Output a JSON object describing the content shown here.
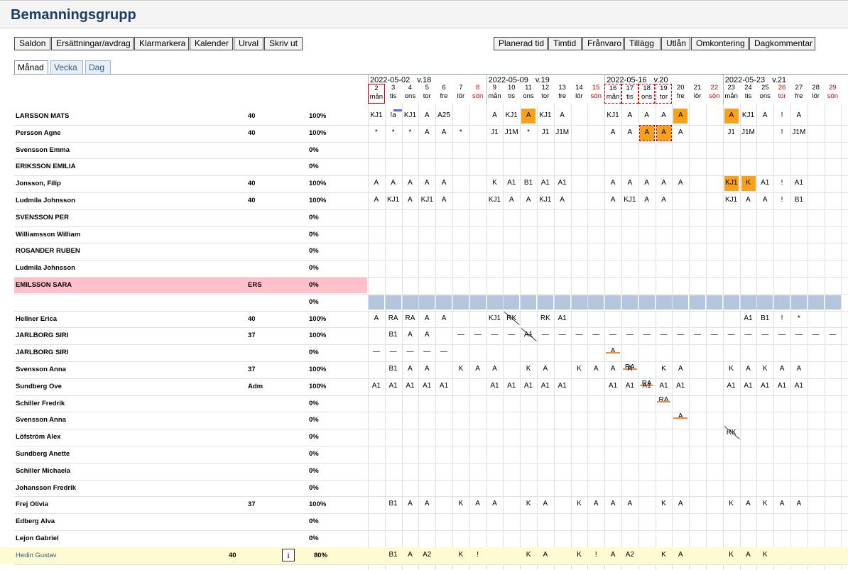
{
  "title": "Bemanningsgrupp",
  "toolbar_left": [
    "Saldon",
    "Ersättningar/avdrag",
    "Klarmarkera",
    "Kalender",
    "Urval",
    "Skriv ut"
  ],
  "toolbar_right": [
    "Planerad tid",
    "Timtid",
    "Frånvaro",
    "Tillägg",
    "Utlån",
    "Omkontering",
    "Dagkommentar"
  ],
  "tabs": [
    "Månad",
    "Vecka",
    "Dag"
  ],
  "weeks": [
    {
      "date": "2022-05-02",
      "week": "v.18"
    },
    {
      "date": "2022-05-09",
      "week": "v.19"
    },
    {
      "date": "2022-05-16",
      "week": "v.20"
    },
    {
      "date": "2022-05-23",
      "week": "v.21"
    }
  ],
  "days": [
    {
      "n": "2",
      "d": "mån"
    },
    {
      "n": "3",
      "d": "tis"
    },
    {
      "n": "4",
      "d": "ons"
    },
    {
      "n": "5",
      "d": "tor"
    },
    {
      "n": "6",
      "d": "fre"
    },
    {
      "n": "7",
      "d": "lör"
    },
    {
      "n": "8",
      "d": "sön"
    },
    {
      "n": "9",
      "d": "mån"
    },
    {
      "n": "10",
      "d": "tis"
    },
    {
      "n": "11",
      "d": "ons"
    },
    {
      "n": "12",
      "d": "tor"
    },
    {
      "n": "13",
      "d": "fre"
    },
    {
      "n": "14",
      "d": "lör"
    },
    {
      "n": "15",
      "d": "sön"
    },
    {
      "n": "16",
      "d": "mån"
    },
    {
      "n": "17",
      "d": "tis"
    },
    {
      "n": "18",
      "d": "ons"
    },
    {
      "n": "19",
      "d": "tor"
    },
    {
      "n": "20",
      "d": "fre"
    },
    {
      "n": "21",
      "d": "lör"
    },
    {
      "n": "22",
      "d": "sön"
    },
    {
      "n": "23",
      "d": "mån"
    },
    {
      "n": "24",
      "d": "tis"
    },
    {
      "n": "25",
      "d": "ons"
    },
    {
      "n": "26",
      "d": "tor"
    },
    {
      "n": "27",
      "d": "fre"
    },
    {
      "n": "28",
      "d": "lör"
    },
    {
      "n": "29",
      "d": "sön"
    }
  ],
  "rows": [
    {
      "name": "LARSSON MATS",
      "hours": "40",
      "pct": "100%",
      "cells": [
        "KJ1",
        "!a",
        "KJ1",
        "A",
        "A25",
        "",
        "",
        "A",
        "KJ1",
        "A",
        "KJ1",
        "A",
        "",
        "",
        "KJ1",
        "A",
        "A",
        "A",
        "A",
        "",
        "",
        "A",
        "KJ1",
        "A",
        "!",
        "A",
        "",
        ""
      ]
    },
    {
      "name": "Persson Agne",
      "hours": "40",
      "pct": "100%",
      "cells": [
        "*",
        "*",
        "*",
        "A",
        "A",
        "*",
        "",
        "J1",
        "J1M",
        "*",
        "J1",
        "J1M",
        "",
        "",
        "A",
        "A",
        "A",
        "A",
        "A",
        "",
        "",
        "J1",
        "J1M",
        "",
        "!",
        "J1M",
        "",
        ""
      ]
    },
    {
      "name": "Svensson Emma",
      "hours": "",
      "pct": "0%",
      "cells": []
    },
    {
      "name": "ERIKSSON EMILIA",
      "hours": "",
      "pct": "0%",
      "cells": []
    },
    {
      "name": "Jonsson, Filip",
      "hours": "40",
      "pct": "100%",
      "cells": [
        "A",
        "A",
        "A",
        "A",
        "A",
        "",
        "",
        "K",
        "A1",
        "B1",
        "A1",
        "A1",
        "",
        "",
        "A",
        "A",
        "A",
        "A",
        "A",
        "",
        "",
        "KJ1",
        "K",
        "A1",
        "!",
        "A1",
        "",
        ""
      ]
    },
    {
      "name": "Ludmila Johnsson",
      "hours": "40",
      "pct": "100%",
      "cells": [
        "A",
        "KJ1",
        "A",
        "KJ1",
        "A",
        "",
        "",
        "KJ1",
        "A",
        "A",
        "KJ1",
        "A",
        "",
        "",
        "A",
        "KJ1",
        "A",
        "A",
        "",
        "",
        "",
        "KJ1",
        "A",
        "A",
        "!",
        "B1",
        "",
        ""
      ]
    },
    {
      "name": "SVENSSON PER",
      "hours": "",
      "pct": "0%",
      "cells": []
    },
    {
      "name": "Williamsson William",
      "hours": "",
      "pct": "0%",
      "cells": []
    },
    {
      "name": "ROSANDER RUBEN",
      "hours": "",
      "pct": "0%",
      "cells": []
    },
    {
      "name": "Ludmila Johnsson",
      "hours": "",
      "pct": "0%",
      "cells": []
    },
    {
      "name": "EMILSSON SARA",
      "hours": "ERS",
      "pct": "0%",
      "cells": []
    },
    {
      "name": "",
      "hours": "",
      "pct": "0%",
      "cells": []
    },
    {
      "name": "Hellner Erica",
      "hours": "40",
      "pct": "100%",
      "cells": [
        "A",
        "RA",
        "RA",
        "A",
        "A",
        "",
        "",
        "KJ1",
        "RK",
        "A1",
        "RK",
        "A1",
        "",
        "",
        "A",
        "RA",
        "RA",
        "RA",
        "A",
        "",
        "",
        "RK",
        "A1",
        "B1",
        "!",
        "*",
        "",
        ""
      ]
    },
    {
      "name": "JARLBORG SIRI",
      "hours": "37",
      "pct": "100%",
      "cells": [
        "",
        "B1",
        "A",
        "A",
        "",
        "—",
        "—",
        "—",
        "—",
        "—",
        "—",
        "—",
        "—",
        "—",
        "—",
        "—",
        "—",
        "—",
        "—",
        "—",
        "—",
        "—",
        "—",
        "—",
        "—",
        "—",
        "—",
        "—"
      ]
    },
    {
      "name": "JARLBORG SIRI",
      "hours": "",
      "pct": "0%",
      "cells": [
        "—",
        "—",
        "—",
        "—",
        "—",
        "",
        "",
        "",
        "",
        "",
        "",
        "",
        "",
        "",
        "",
        "",
        "",
        "",
        "",
        "",
        "",
        "",
        "",
        "",
        "",
        "",
        "",
        ""
      ]
    },
    {
      "name": "Svensson Anna",
      "hours": "37",
      "pct": "100%",
      "cells": [
        "",
        "B1",
        "A",
        "A",
        "",
        "K",
        "A",
        "A",
        "",
        "K",
        "A",
        "",
        "K",
        "A",
        "A",
        "A",
        "",
        "K",
        "A",
        "",
        "",
        "K",
        "A",
        "K",
        "A",
        "A",
        "",
        ""
      ]
    },
    {
      "name": "Sundberg Ove",
      "hours": "Adm",
      "pct": "100%",
      "cells": [
        "A1",
        "A1",
        "A1",
        "A1",
        "A1",
        "",
        "",
        "A1",
        "A1",
        "A1",
        "A1",
        "A1",
        "",
        "",
        "A1",
        "A1",
        "A1",
        "A1",
        "A1",
        "",
        "",
        "A1",
        "A1",
        "A1",
        "A1",
        "A1",
        "",
        ""
      ]
    },
    {
      "name": "Schiller Fredrik",
      "hours": "",
      "pct": "0%",
      "cells": []
    },
    {
      "name": "Svensson Anna",
      "hours": "",
      "pct": "0%",
      "cells": []
    },
    {
      "name": "Löfström Alex",
      "hours": "",
      "pct": "0%",
      "cells": []
    },
    {
      "name": "Sundberg Anette",
      "hours": "",
      "pct": "0%",
      "cells": []
    },
    {
      "name": "Schiller Michaela",
      "hours": "",
      "pct": "0%",
      "cells": []
    },
    {
      "name": "Johansson Fredrik",
      "hours": "",
      "pct": "0%",
      "cells": []
    },
    {
      "name": "Frej Olivia",
      "hours": "37",
      "pct": "100%",
      "cells": [
        "",
        "B1",
        "A",
        "A",
        "",
        "K",
        "A",
        "A",
        "",
        "K",
        "A",
        "",
        "K",
        "A",
        "A",
        "A",
        "",
        "K",
        "A",
        "",
        "",
        "K",
        "A",
        "K",
        "A",
        "A",
        "",
        ""
      ]
    },
    {
      "name": "Edberg Alva",
      "hours": "",
      "pct": "0%",
      "cells": []
    },
    {
      "name": "Lejon Gabriel",
      "hours": "",
      "pct": "0%",
      "cells": []
    },
    {
      "name": "Hedin Gustav",
      "hours": "40",
      "pct": "80%",
      "cells": [
        "",
        "B1",
        "A",
        "A2",
        "",
        "K",
        "!",
        "",
        "",
        "K",
        "A",
        "",
        "K",
        "!",
        "A",
        "A2",
        "",
        "K",
        "A",
        "",
        "",
        "K",
        "A",
        "K",
        "",
        "",
        "",
        ""
      ]
    }
  ],
  "colors": {
    "orange": "#f7a019",
    "pink": "#ffc0cb",
    "yellow": "#fffbd1",
    "blue_cell": "#b3c6de",
    "title": "#1b3c63"
  }
}
